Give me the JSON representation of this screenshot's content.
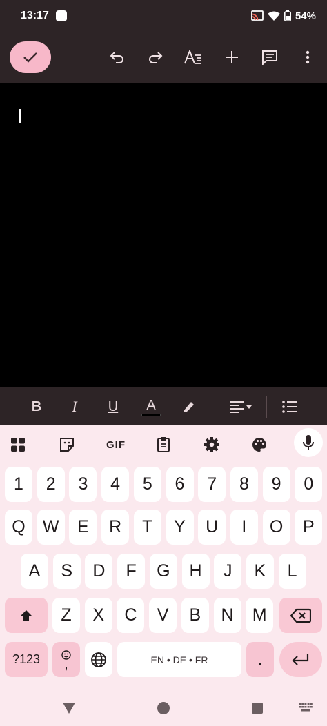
{
  "status_bar": {
    "time": "13:17",
    "battery": "54%"
  },
  "toolbar": {
    "icons": [
      "check-icon",
      "undo-icon",
      "redo-icon",
      "text-format-icon",
      "plus-icon",
      "comment-icon",
      "more-vertical-icon"
    ]
  },
  "format_bar": {
    "bold": "B",
    "italic": "I",
    "underline": "U",
    "text_color": "A"
  },
  "keyboard_toolbar": {
    "gif": "GIF"
  },
  "keyboard": {
    "row_numbers": [
      "1",
      "2",
      "3",
      "4",
      "5",
      "6",
      "7",
      "8",
      "9",
      "0"
    ],
    "row_top": [
      "Q",
      "W",
      "E",
      "R",
      "T",
      "Y",
      "U",
      "I",
      "O",
      "P"
    ],
    "row_home": [
      "A",
      "S",
      "D",
      "F",
      "G",
      "H",
      "J",
      "K",
      "L"
    ],
    "row_bottom": [
      "Z",
      "X",
      "C",
      "V",
      "B",
      "N",
      "M"
    ],
    "symbols_key": "?123",
    "emoji_comma": ",",
    "space_label": "EN • DE • FR",
    "period": "."
  },
  "colors": {
    "accent_pink": "#f7b8c9",
    "toolbar_bg": "#2d2426",
    "editor_bg": "#000000",
    "keyboard_bg": "#fbe9ee"
  }
}
